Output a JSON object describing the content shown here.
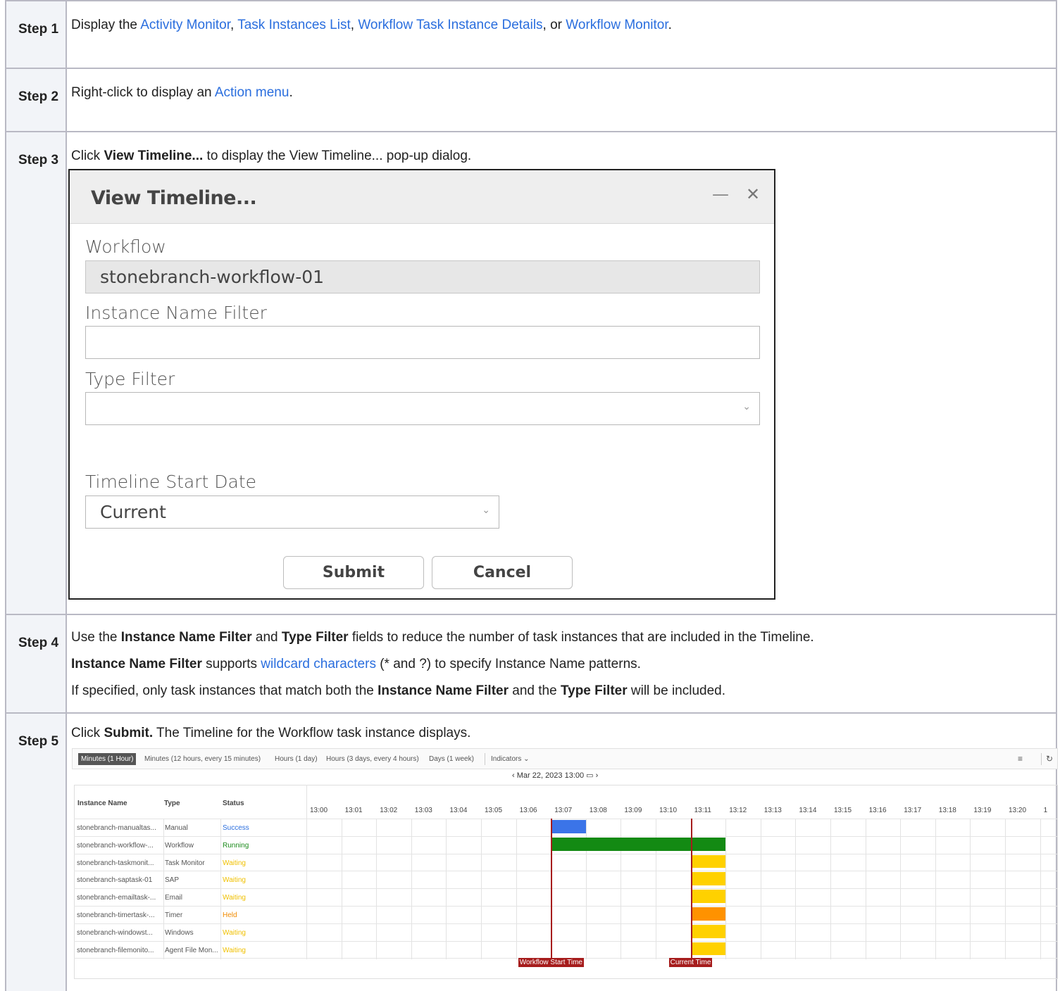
{
  "steps": [
    {
      "label": "Step 1"
    },
    {
      "label": "Step 2"
    },
    {
      "label": "Step 3"
    },
    {
      "label": "Step 4"
    },
    {
      "label": "Step 5"
    }
  ],
  "step1": {
    "prefix": "Display the ",
    "link1": "Activity Monitor",
    "sep1": ", ",
    "link2": "Task Instances List",
    "sep2": ", ",
    "link3": "Workflow Task Instance Details",
    "sep3": ", or ",
    "link4": "Workflow Monitor",
    "suffix": "."
  },
  "step2": {
    "prefix": "Right-click to display an ",
    "link": "Action menu",
    "suffix": "."
  },
  "step3": {
    "prefix": "Click ",
    "bold": "View Timeline...",
    "suffix": " to display the View Timeline... pop-up dialog."
  },
  "dialog": {
    "title": "View Timeline...",
    "minimize_glyph": "—",
    "close_glyph": "✕",
    "workflow_label": "Workflow",
    "workflow_value": "stonebranch-workflow-01",
    "instance_filter_label": "Instance Name Filter",
    "instance_filter_value": "",
    "type_filter_label": "Type Filter",
    "type_filter_value": "",
    "start_date_label": "Timeline Start Date",
    "start_date_value": "Current",
    "submit_label": "Submit",
    "cancel_label": "Cancel"
  },
  "step4": {
    "l1_a": "Use the ",
    "l1_b": "Instance Name Filter",
    "l1_c": " and ",
    "l1_d": "Type Filter",
    "l1_e": " fields to ",
    "l1_f": "reduce the number of task instances that are included in the Timeline.",
    "l2_a": "Instance Name Filter",
    "l2_b": " supports ",
    "l2_link": "wildcard characters",
    "l2_c": " (* and ?) to specify Instance Name patterns.",
    "l3_a": "If specified, only task instances that match both the ",
    "l3_b": "Instance Name Filter",
    "l3_c": " and the ",
    "l3_d": "Type Filter",
    "l3_e": " will be included."
  },
  "step5": {
    "prefix": "Click ",
    "bold": "Submit.",
    "suffix": " The Timeline for the Workflow task instance displays."
  },
  "timeline": {
    "tabs": [
      "Minutes (1 Hour)",
      "Minutes (12 hours, every 15 minutes)",
      "Hours (1 day)",
      "Hours (3 days, every 4 hours)",
      "Days (1 week)",
      "Indicators ⌄"
    ],
    "active_tab": 0,
    "nav_date": "‹   Mar 22, 2023 13:00  ▭   ›",
    "columns": [
      "Instance Name",
      "Type",
      "Status"
    ],
    "times": [
      "13:00",
      "13:01",
      "13:02",
      "13:03",
      "13:04",
      "13:05",
      "13:06",
      "13:07",
      "13:08",
      "13:09",
      "13:10",
      "13:11",
      "13:12",
      "13:13",
      "13:14",
      "13:15",
      "13:16",
      "13:17",
      "13:18",
      "13:19",
      "13:20",
      "1"
    ],
    "rows": [
      {
        "name": "stonebranch-manualtas...",
        "type": "Manual",
        "status": "Success",
        "status_color": "#2a6ede"
      },
      {
        "name": "stonebranch-workflow-...",
        "type": "Workflow",
        "status": "Running",
        "status_color": "#1a8a1a"
      },
      {
        "name": "stonebranch-taskmonit...",
        "type": "Task Monitor",
        "status": "Waiting",
        "status_color": "#f0c000"
      },
      {
        "name": "stonebranch-saptask-01",
        "type": "SAP",
        "status": "Waiting",
        "status_color": "#f0c000"
      },
      {
        "name": "stonebranch-emailtask-...",
        "type": "Email",
        "status": "Waiting",
        "status_color": "#f0c000"
      },
      {
        "name": "stonebranch-timertask-...",
        "type": "Timer",
        "status": "Held",
        "status_color": "#f08a00"
      },
      {
        "name": "stonebranch-windowst...",
        "type": "Windows",
        "status": "Waiting",
        "status_color": "#f0c000"
      },
      {
        "name": "stonebranch-filemonito...",
        "type": "Agent File Mon...",
        "status": "Waiting",
        "status_color": "#f0c000"
      }
    ],
    "markers": [
      "Workflow Start Time",
      "Current Time"
    ],
    "colors": {
      "success": "#3b74e8",
      "running": "#138a13",
      "waiting": "#ffd100",
      "held": "#ff9200",
      "marker": "#a61c1c"
    }
  }
}
